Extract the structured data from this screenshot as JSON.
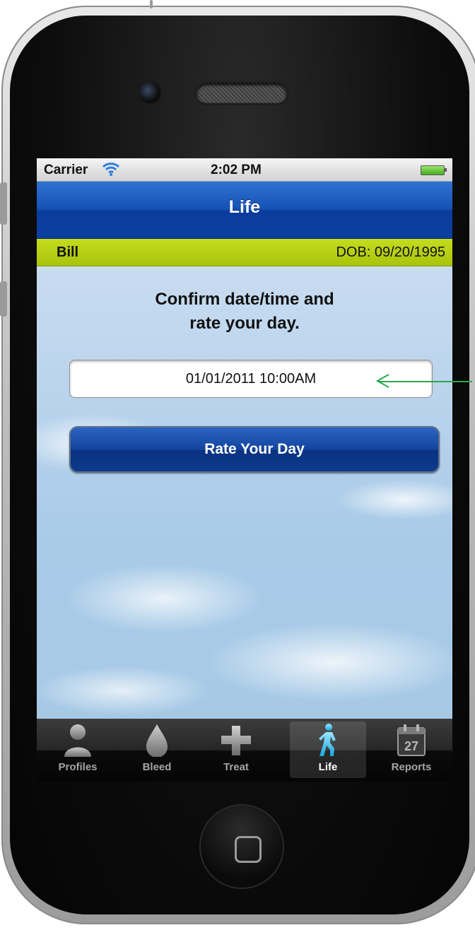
{
  "status_bar": {
    "carrier": "Carrier",
    "time": "2:02 PM",
    "wifi_icon": "wifi-icon",
    "battery_icon": "battery-icon"
  },
  "nav": {
    "title": "Life"
  },
  "patient": {
    "name": "Bill",
    "dob": "DOB: 09/20/1995"
  },
  "content": {
    "prompt_line1": "Confirm date/time and",
    "prompt_line2": "rate your day.",
    "datetime_value": "01/01/2011 10:00AM",
    "rate_button_label": "Rate Your Day"
  },
  "tabs": [
    {
      "label": "Profiles",
      "icon": "person-icon",
      "active": false
    },
    {
      "label": "Bleed",
      "icon": "drop-icon",
      "active": false
    },
    {
      "label": "Treat",
      "icon": "cross-icon",
      "active": false
    },
    {
      "label": "Life",
      "icon": "walking-person-icon",
      "active": true
    },
    {
      "label": "Reports",
      "icon": "calendar-icon",
      "active": false,
      "badge": "27"
    }
  ],
  "colors": {
    "nav_blue": "#1752b6",
    "patient_bar_green": "#b5cd14",
    "tab_active_icon": "#3cc0f0",
    "annotation_arrow": "#2aa84a"
  }
}
